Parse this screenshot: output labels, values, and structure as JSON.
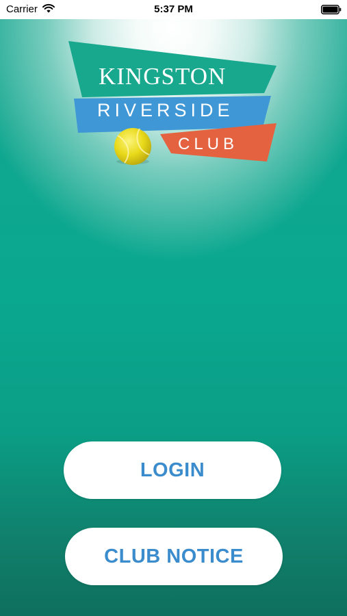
{
  "status_bar": {
    "carrier": "Carrier",
    "time": "5:37 PM",
    "wifi_icon": "wifi-icon",
    "battery_icon": "battery-icon"
  },
  "logo": {
    "line1": "KINGSTON",
    "line2": "RIVERSIDE",
    "line3": "CLUB",
    "colors": {
      "kingston_band": "#17a88e",
      "riverside_band": "#3f97d6",
      "club_band": "#e4623f",
      "ball": "#e9d91a"
    }
  },
  "actions": {
    "login_label": "LOGIN",
    "club_notice_label": "CLUB NOTICE"
  },
  "colors": {
    "accent_text": "#3b8ccd",
    "background": "#0aa88f"
  }
}
